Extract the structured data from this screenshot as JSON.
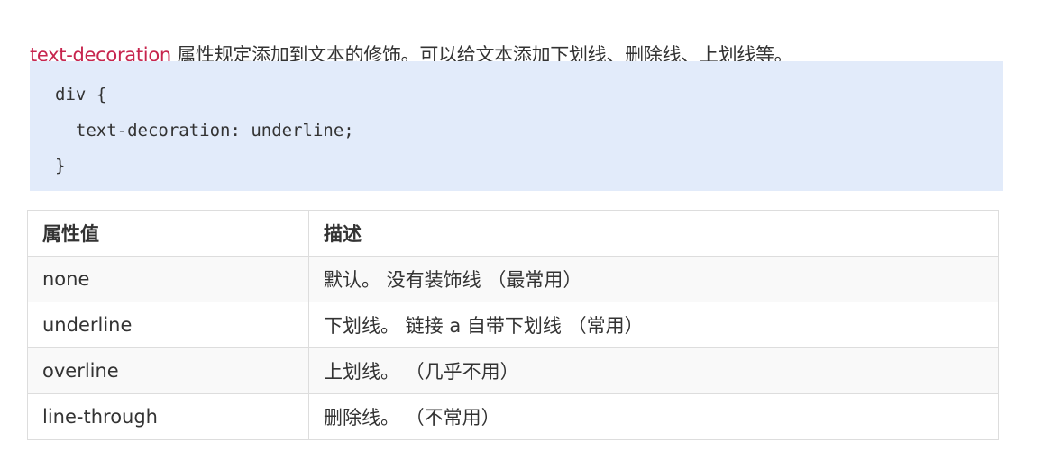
{
  "intro": {
    "keyword": "text-decoration",
    "text": " 属性规定添加到文本的修饰。可以给文本添加下划线、删除线、上划线等。"
  },
  "code": [
    "div {",
    "  text-decoration: underline;",
    "}"
  ],
  "table": {
    "headers": [
      "属性值",
      "描述"
    ],
    "rows": [
      [
        "none",
        "默认。 没有装饰线 （最常用）"
      ],
      [
        "underline",
        "下划线。 链接 a 自带下划线 （常用）"
      ],
      [
        "overline",
        "上划线。 （几乎不用）"
      ],
      [
        "line-through",
        "删除线。 （不常用）"
      ]
    ]
  },
  "colors": {
    "keyword": "#c7254e",
    "code_background": "#e2ebfa",
    "table_border": "#dddddd",
    "row_stripe": "#f9f9f9"
  }
}
